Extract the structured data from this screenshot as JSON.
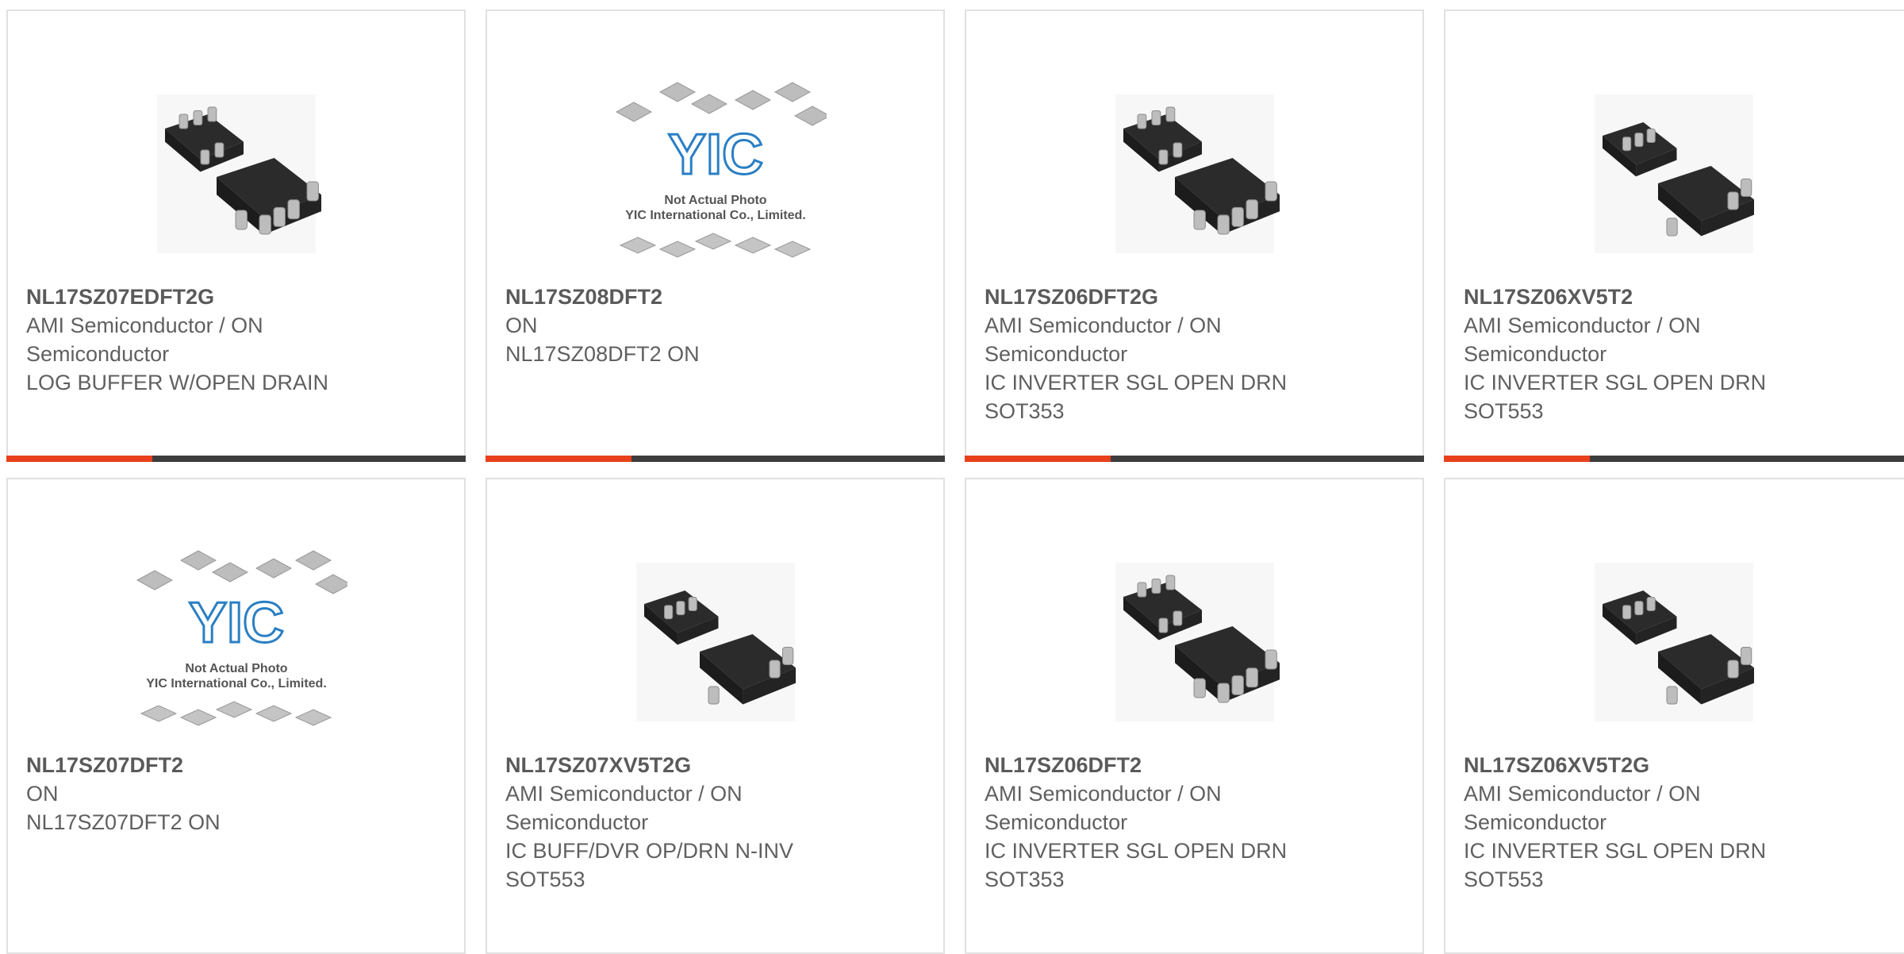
{
  "colors": {
    "accent": "#e8401c",
    "bar": "#3d3d3d",
    "border": "#e1e1e1"
  },
  "placeholder": {
    "l1": "Not Actual Photo",
    "l2": "YIC International Co., Limited.",
    "logo": "YIC"
  },
  "products": [
    {
      "pn": "NL17SZ07EDFT2G",
      "lines": [
        "AMI Semiconductor / ON",
        "Semiconductor",
        "LOG BUFFER W/OPEN DRAIN"
      ],
      "img": "sot353-chip-image"
    },
    {
      "pn": "NL17SZ08DFT2",
      "lines": [
        "ON",
        "NL17SZ08DFT2 ON"
      ],
      "img": "placeholder-image"
    },
    {
      "pn": "NL17SZ06DFT2G",
      "lines": [
        "AMI Semiconductor / ON",
        "Semiconductor",
        "IC INVERTER SGL OPEN DRN",
        "SOT353"
      ],
      "img": "sot353-chip-image"
    },
    {
      "pn": "NL17SZ06XV5T2",
      "lines": [
        "AMI Semiconductor / ON",
        "Semiconductor",
        "IC INVERTER SGL OPEN DRN",
        "SOT553"
      ],
      "img": "sot553-chip-image"
    },
    {
      "pn": "NL17SZ07DFT2",
      "lines": [
        "ON",
        "NL17SZ07DFT2 ON"
      ],
      "img": "placeholder-image"
    },
    {
      "pn": "NL17SZ07XV5T2G",
      "lines": [
        "AMI Semiconductor / ON",
        "Semiconductor",
        "IC BUFF/DVR OP/DRN N-INV",
        "SOT553"
      ],
      "img": "sot553-chip-image"
    },
    {
      "pn": "NL17SZ06DFT2",
      "lines": [
        "AMI Semiconductor / ON",
        "Semiconductor",
        "IC INVERTER SGL OPEN DRN",
        "SOT353"
      ],
      "img": "sot353-chip-image"
    },
    {
      "pn": "NL17SZ06XV5T2G",
      "lines": [
        "AMI Semiconductor / ON",
        "Semiconductor",
        "IC INVERTER SGL OPEN DRN",
        "SOT553"
      ],
      "img": "sot553-chip-image"
    }
  ]
}
